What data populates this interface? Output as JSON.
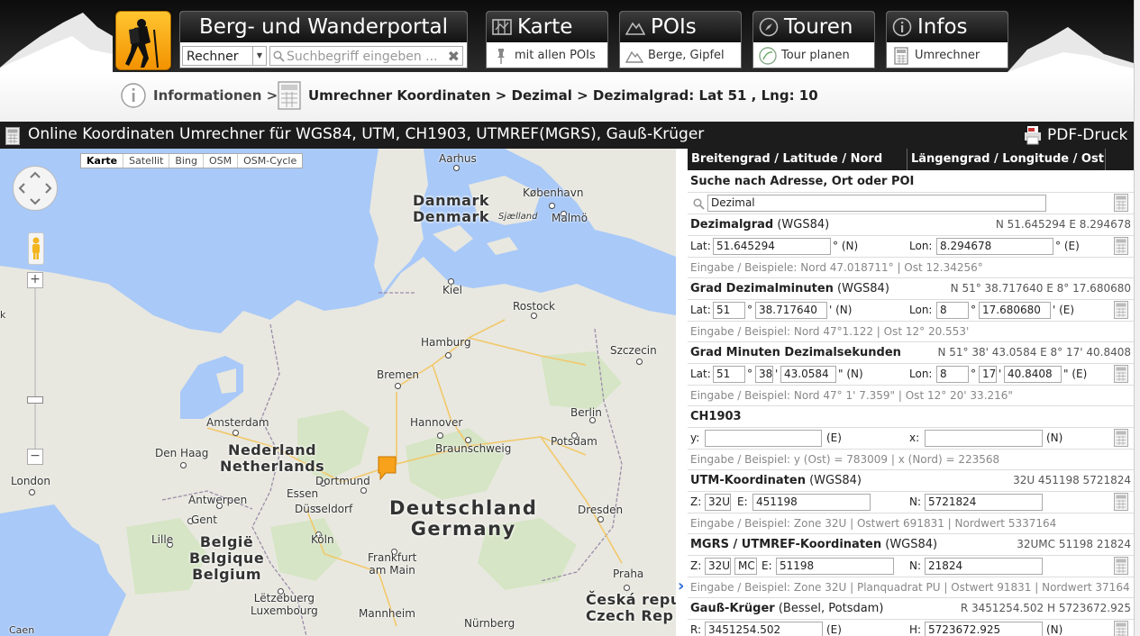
{
  "nav": {
    "portal_title": "Berg- und Wanderportal",
    "rechner_select": "Rechner",
    "search_placeholder": "Suchbegriff eingeben ...",
    "tabs": [
      {
        "title": "Karte",
        "sub": "mit allen POIs"
      },
      {
        "title": "POIs",
        "sub": "Berge, Gipfel"
      },
      {
        "title": "Touren",
        "sub": "Tour planen"
      },
      {
        "title": "Infos",
        "sub": "Umrechner"
      }
    ]
  },
  "breadcrumb": {
    "root": "Informationen >",
    "path": "Umrechner Koordinaten > Dezimal > Dezimalgrad: Lat 51 , Lng: 10"
  },
  "titlebar": {
    "title": "Online Koordinaten Umrechner für WGS84, UTM, CH1903, UTMREF(MGRS), Gauß-Krüger",
    "pdf": "PDF-Druck"
  },
  "map": {
    "types": [
      "Karte",
      "Satellit",
      "Bing",
      "OSM",
      "OSM-Cycle"
    ],
    "active_type": "Karte",
    "labels": {
      "aarhus": "Aarhus",
      "kobenhavn": "København",
      "sjaelland": "Sjælland",
      "malmo": "Malmö",
      "kiel": "Kiel",
      "rostock": "Rostock",
      "hamburg": "Hamburg",
      "szczecin": "Szczecin",
      "bremen": "Bremen",
      "berlin": "Berlin",
      "amsterdam": "Amsterdam",
      "hannover": "Hannover",
      "potsdam": "Potsdam",
      "braunschweig": "Braunschweig",
      "denhaag": "Den Haag",
      "london": "London",
      "dortmund": "Dortmund",
      "essen": "Essen",
      "antwerpen": "Antwerpen",
      "dusseldorf": "Düsseldorf",
      "gent": "Gent",
      "dresden": "Dresden",
      "lille": "Lille",
      "koln": "Köln",
      "frankfurt": "Frankfurt\nam Main",
      "praha": "Praha",
      "letzebuerg": "Lëtzebuerg\nLuxembourg",
      "mannheim": "Mannheim",
      "nurnberg": "Nürnberg",
      "caen": "Caen",
      "k": "k"
    },
    "countries": {
      "danmark": "Danmark\nDenmark",
      "nederland": "Nederland\nNetherlands",
      "deutschland": "Deutschland\nGermany",
      "belgie": "België\nBelgique\nBelgium",
      "cesko": "Česká repu\nCzech Rep"
    }
  },
  "converter": {
    "headers": [
      "Breitengrad / Latitude / Nord",
      "Längengrad / Longitude / Ost"
    ],
    "search_label": "Suche nach Adresse, Ort oder POI",
    "search_value": "Dezimal",
    "dez": {
      "title": "Dezimalgrad",
      "datum": "(WGS84)",
      "result": "N 51.645294 E 8.294678",
      "lat_label": "Lat:",
      "lat": "51.645294",
      "lat_unit": "° (N)",
      "lon_label": "Lon:",
      "lon": "8.294678",
      "lon_unit": "° (E)",
      "hint": "Eingabe / Beispiele: Nord 47.018711° | Ost 12.34256°"
    },
    "gdm": {
      "title": "Grad Dezimalminuten",
      "datum": "(WGS84)",
      "result": "N 51° 38.717640 E 8° 17.680680",
      "lat_deg": "51",
      "lat_min": "38.717640",
      "lat_unit": "' (N)",
      "lon_deg": "8",
      "lon_min": "17.680680",
      "lon_unit": "' (E)",
      "deg_sym": "°",
      "hint": "Eingabe / Beispiel: Nord 47°1.122 | Ost 12° 20.553'"
    },
    "gms": {
      "title": "Grad Minuten Dezimalsekunden",
      "result": "N 51° 38' 43.0584 E 8° 17' 40.8408",
      "lat_deg": "51",
      "lat_min": "38",
      "lat_sec": "43.0584",
      "lat_unit": "\" (N)",
      "lon_deg": "8",
      "lon_min": "17",
      "lon_sec": "40.8408",
      "lon_unit": "\" (E)",
      "min_sym": "'",
      "hint": "Eingabe / Beispiel: Nord 47° 1' 7.359\" | Ost 12° 20' 33.216\""
    },
    "ch": {
      "title": "CH1903",
      "y_label": "y:",
      "y": "",
      "y_unit": "(E)",
      "x_label": "x:",
      "x": "",
      "x_unit": "(N)",
      "hint": "Eingabe / Beispiel: y (Ost) = 783009 | x (Nord) = 223568"
    },
    "utm": {
      "title": "UTM-Koordinaten",
      "datum": "(WGS84)",
      "result": "32U 451198 5721824",
      "z_label": "Z:",
      "zone": "32U",
      "e_label": "E:",
      "e": "451198",
      "n_label": "N:",
      "n": "5721824",
      "hint": "Eingabe / Beispiel: Zone 32U | Ostwert 691831 | Nordwert 5337164"
    },
    "mgrs": {
      "title": "MGRS / UTMREF-Koordinaten",
      "datum": "(WGS84)",
      "result": "32UMC 51198 21824",
      "zone": "32U",
      "square": "MC",
      "e": "51198",
      "n": "21824",
      "hint": "Eingabe / Beispiel: Zone 32U | Planquadrat PU | Ostwert 91831 | Nordwert 37164"
    },
    "gk": {
      "title": "Gauß-Krüger",
      "datum": "(Bessel, Potsdam)",
      "result": "R 3451254.502 H 5723672.925",
      "r_label": "R:",
      "r": "3451254.502",
      "r_unit": "(E)",
      "h_label": "H:",
      "h": "5723672.925",
      "h_unit": "(N)"
    }
  }
}
